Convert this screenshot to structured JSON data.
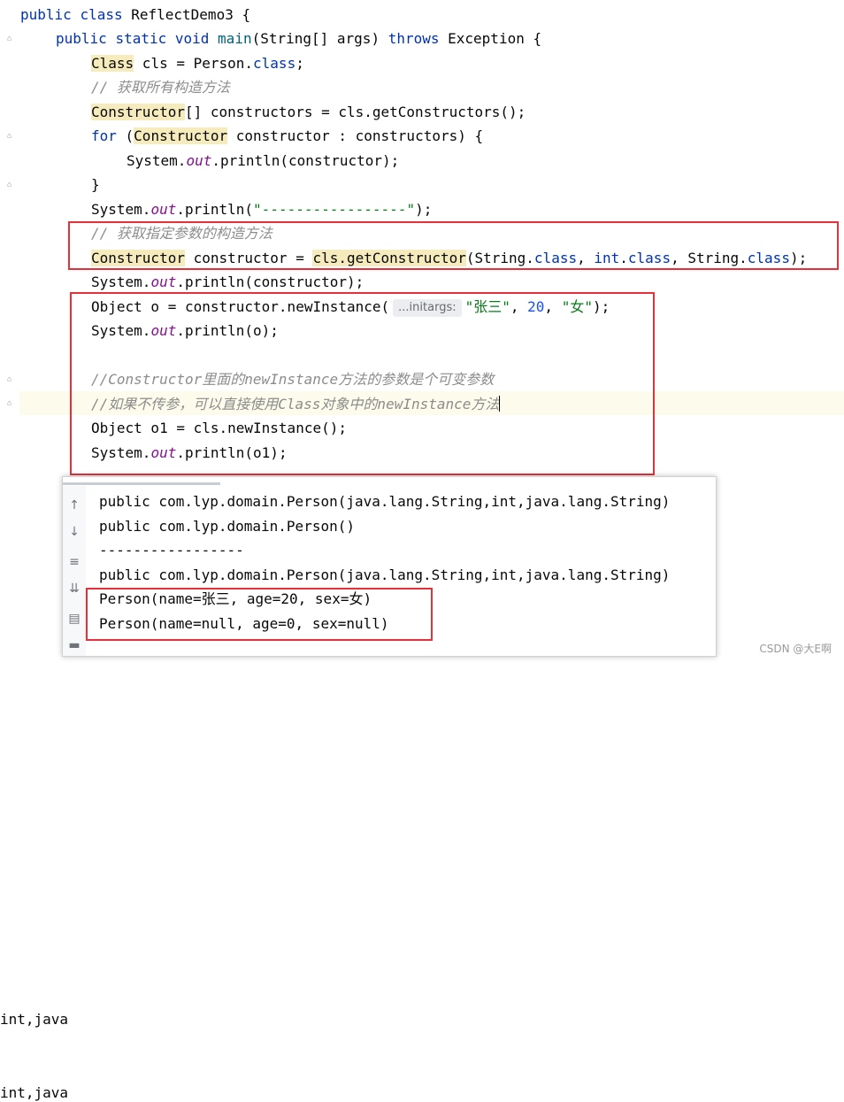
{
  "code": {
    "l1": {
      "kw1": "public ",
      "kw2": "class ",
      "name": "ReflectDemo3 {"
    },
    "l2": {
      "kw1": "public ",
      "kw2": "static ",
      "kw3": "void ",
      "method": "main",
      "args": "(String[] args) ",
      "kw4": "throws ",
      "rest": "Exception {"
    },
    "l3": {
      "cls": "Class",
      "a": " cls = Person.",
      "kw": "class",
      "b": ";"
    },
    "l4": {
      "comment": "// 获取所有构造方法"
    },
    "l5": {
      "cls": "Constructor",
      "rest": "[] constructors = cls.getConstructors();"
    },
    "l6": {
      "kw": "for ",
      "a": "(",
      "cls": "Constructor",
      "b": " constructor : constructors) {"
    },
    "l7": {
      "a": "System.",
      "fld": "out",
      "b": ".println(constructor);"
    },
    "l8": {
      "a": "}"
    },
    "l9": {
      "a": "System.",
      "fld": "out",
      "b": ".println(",
      "str": "\"-----------------\"",
      "c": ");"
    },
    "l10": {
      "comment": "// 获取指定参数的构造方法"
    },
    "l11": {
      "cls": "Constructor",
      "a": " constructor = ",
      "call": "cls.getConstructor",
      "b": "(String.",
      "kw1": "class",
      "c": ", ",
      "kw2": "int",
      "d": ".",
      "kw3": "class",
      "e": ", String.",
      "kw4": "class",
      "f": ");"
    },
    "l12": {
      "a": "System.",
      "fld": "out",
      "b": ".println(constructor);"
    },
    "l13": {
      "a": "Object o = constructor.newInstance(",
      "hint": "...initargs:",
      "s1": "\"张三\"",
      "c1": ", ",
      "num": "20",
      "c2": ", ",
      "s2": "\"女\"",
      "end": ");"
    },
    "l14": {
      "a": "System.",
      "fld": "out",
      "b": ".println(o);"
    },
    "l16": {
      "comment": "//Constructor里面的newInstance方法的参数是个可变参数"
    },
    "l17": {
      "comment": "//如果不传参，可以直接使用Class对象中的newInstance方法"
    },
    "l18": {
      "a": "Object o1 = cls.newInstance();"
    },
    "l19": {
      "a": "System.",
      "fld": "out",
      "b": ".println(o1);"
    }
  },
  "left_fragments": [
    "int,java",
    "int,java"
  ],
  "output": [
    "public com.lyp.domain.Person(java.lang.String,int,java.lang.String)",
    "public com.lyp.domain.Person()",
    "-----------------",
    "public com.lyp.domain.Person(java.lang.String,int,java.lang.String)",
    "Person(name=张三, age=20, sex=女)",
    "Person(name=null, age=0, sex=null)"
  ],
  "toolbar_icons": [
    "arrow-up-icon",
    "arrow-down-icon",
    "soft-wrap-icon",
    "scroll-to-end-icon",
    "print-icon",
    "trash-icon"
  ],
  "watermark": "CSDN @大E啊",
  "colors": {
    "keyword": "#0033b3",
    "comment": "#8c8c8c",
    "field": "#871094",
    "string": "#067d17",
    "number": "#1750eb",
    "highlight": "#f6ebbc",
    "annotation_box": "#e8303a"
  }
}
